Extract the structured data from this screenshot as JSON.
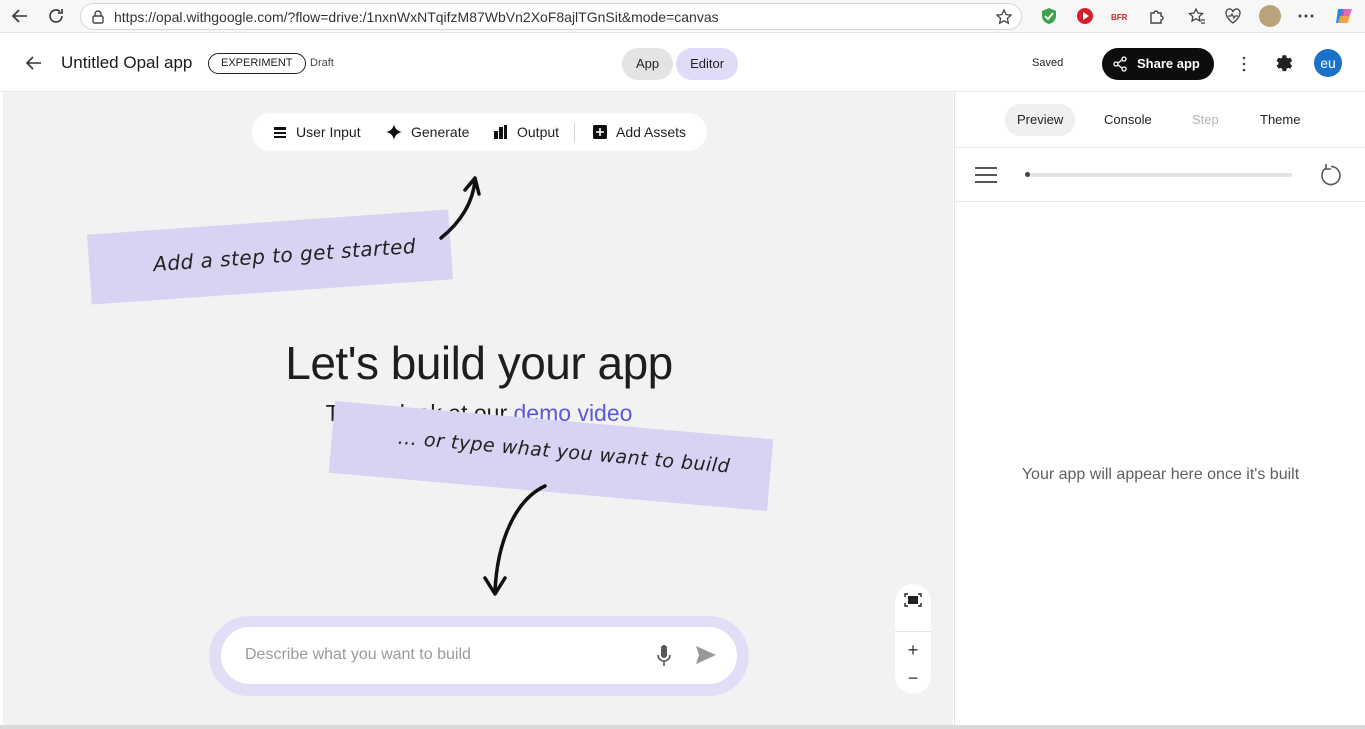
{
  "browser": {
    "url": "https://opal.withgoogle.com/?flow=drive:/1nxnWxNTqifzM87WbVn2XoF8ajlTGnSit&mode=canvas"
  },
  "header": {
    "title": "Untitled Opal app",
    "badge": "EXPERIMENT",
    "status": "Draft",
    "toggle_app": "App",
    "toggle_editor": "Editor",
    "saved": "Saved",
    "share": "Share app",
    "avatar": "eu"
  },
  "toolbar": {
    "user_input": "User Input",
    "generate": "Generate",
    "output": "Output",
    "add_assets": "Add Assets"
  },
  "canvas": {
    "note_top": "Add a step to get started",
    "heading": "Let's build your app",
    "subheading_prefix": "Take a look at our ",
    "subheading_link": "demo video",
    "note_bottom": "... or type what you want to build",
    "prompt_placeholder": "Describe what you want to build"
  },
  "panel": {
    "tabs": [
      "Preview",
      "Console",
      "Step",
      "Theme"
    ],
    "empty_message": "Your app will appear here once it's built"
  },
  "colors": {
    "accent_link": "#5b57de",
    "note_bg": "#d6d3f3",
    "share_bg": "#0d0d0d",
    "avatar_bg": "#1a73c8"
  }
}
